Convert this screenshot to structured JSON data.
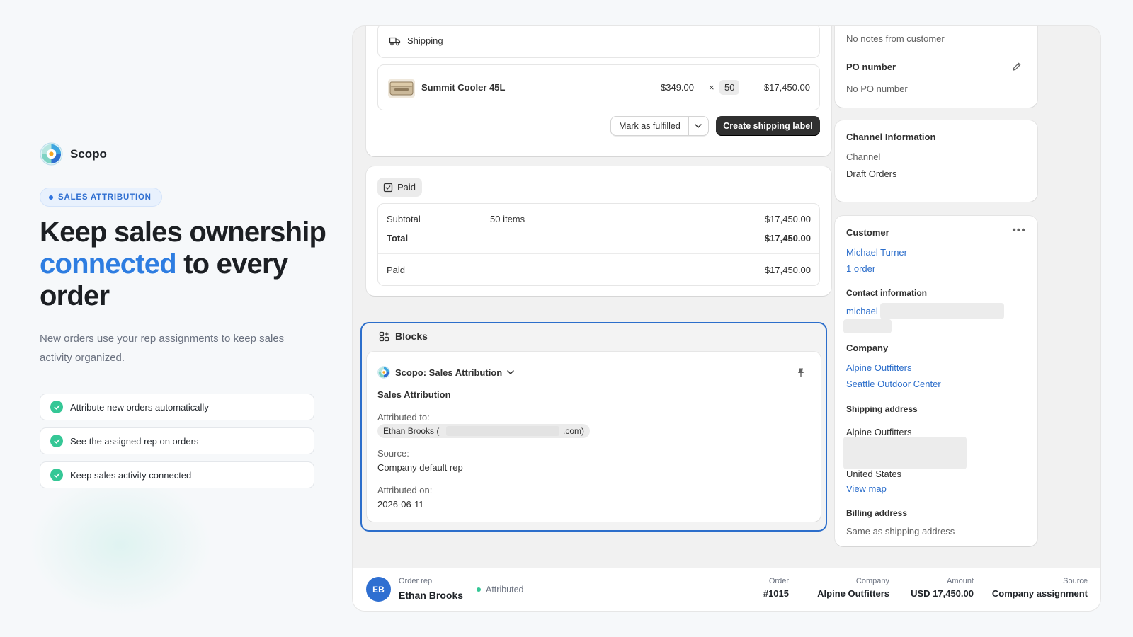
{
  "brand": {
    "name": "Scopo",
    "logo": "scopo-logo"
  },
  "hero": {
    "badge": "SALES ATTRIBUTION",
    "title_a": "Keep sales ownership",
    "title_accent": "connected",
    "title_b": " to every",
    "title_c": "order",
    "subtitle": "New orders use your rep assignments to keep sales activity organized.",
    "accent_color": "#2e7de1",
    "features": [
      "Attribute new orders automatically",
      "See the assigned rep on orders",
      "Keep sales activity connected"
    ]
  },
  "shipping": {
    "title": "Shipping",
    "icon": "truck-icon",
    "item": {
      "name": "Summit Cooler 45L",
      "price": "$349.00",
      "times": "×",
      "qty": "50",
      "total": "$17,450.00"
    },
    "mark_fulfilled": "Mark as fulfilled",
    "create_label": "Create shipping label"
  },
  "payment": {
    "status": "Paid",
    "subtotal_label": "Subtotal",
    "subtotal_items": "50 items",
    "subtotal_value": "$17,450.00",
    "total_label": "Total",
    "total_value": "$17,450.00",
    "paid_label": "Paid",
    "paid_value": "$17,450.00"
  },
  "blocks": {
    "title": "Blocks",
    "extension_name": "Scopo: Sales Attribution",
    "section_title": "Sales Attribution",
    "attributed_to_label": "Attributed to:",
    "attributed_to_name": "Ethan Brooks (",
    "attributed_to_tail": ".com)",
    "source_label": "Source:",
    "source_value": "Company default rep",
    "attributed_on_label": "Attributed on:",
    "attributed_on_value": "2026-06-11"
  },
  "notes": {
    "text": "No notes from customer",
    "po_title": "PO number",
    "po_value": "No PO number"
  },
  "channel": {
    "title": "Channel Information",
    "label": "Channel",
    "value": "Draft Orders"
  },
  "customer": {
    "title": "Customer",
    "name": "Michael Turner",
    "orders": "1 order",
    "contact_title": "Contact information",
    "email_visible": "michael",
    "company_title": "Company",
    "company": "Alpine Outfitters",
    "location": "Seattle Outdoor Center",
    "shipping_title": "Shipping address",
    "ship_line1": "Alpine Outfitters",
    "ship_country": "United States",
    "view_map": "View map",
    "billing_title": "Billing address",
    "billing_value": "Same as shipping address"
  },
  "footer": {
    "avatar_initials": "EB",
    "rep_label": "Order rep",
    "rep_name": "Ethan Brooks",
    "status": "Attributed",
    "order_label": "Order",
    "order_value": "#1015",
    "company_label": "Company",
    "company_value": "Alpine Outfitters",
    "amount_label": "Amount",
    "amount_value": "USD 17,450.00",
    "source_label": "Source",
    "source_value": "Company assignment"
  }
}
